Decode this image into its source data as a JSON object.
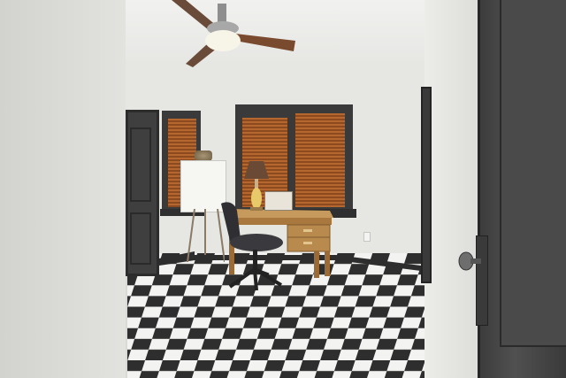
{
  "scene": {
    "description_tag": "home-office-room",
    "colors": {
      "wall": "#e6e6e3",
      "trim": "#3a3a3a",
      "floor_dark": "#2e2e2e",
      "floor_light": "#f3f3f1",
      "blinds": "#b4672f",
      "desk_wood": "#b98a4e",
      "lamp_shade": "#6a4a34"
    },
    "icons": {
      "fan": "ceiling-fan-icon",
      "lamp": "table-lamp-icon",
      "chair": "office-chair-icon",
      "handle": "door-handle-icon"
    }
  }
}
